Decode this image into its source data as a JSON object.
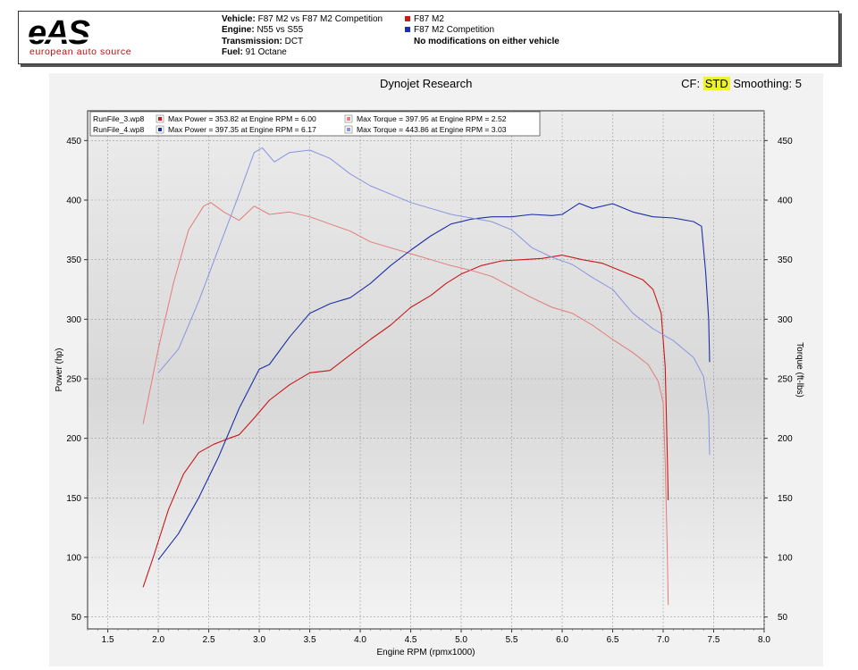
{
  "header": {
    "logo_text": "eAS",
    "logo_subtitle": "european auto source",
    "vehicle_label": "Vehicle:",
    "vehicle_value": "F87 M2 vs F87 M2 Competition",
    "engine_label": "Engine:",
    "engine_value": "N55 vs S55",
    "transmission_label": "Transmission:",
    "transmission_value": "DCT",
    "fuel_label": "Fuel:",
    "fuel_value": "91 Octane",
    "legend_1": "F87 M2",
    "legend_1_color": "#d01818",
    "legend_2": "F87 M2 Competition",
    "legend_2_color": "#1c2fb0",
    "note": "No modifications on either vehicle"
  },
  "dyno": {
    "title": "Dynojet Research",
    "cf_label": "CF:",
    "cf_value": "STD",
    "smoothing_label": "Smoothing:",
    "smoothing_value": "5"
  },
  "chart_data": {
    "type": "line",
    "xlabel": "Engine RPM (rpmx1000)",
    "ylabel_left": "Power (hp)",
    "ylabel_right": "Torque (ft-lbs)",
    "xlim": [
      1.3,
      8.0
    ],
    "ylim": [
      40,
      475
    ],
    "x_ticks": [
      1.5,
      2.0,
      2.5,
      3.0,
      3.5,
      4.0,
      4.5,
      5.0,
      5.5,
      6.0,
      6.5,
      7.0,
      7.5,
      8.0
    ],
    "y_ticks": [
      50,
      100,
      150,
      200,
      250,
      300,
      350,
      400,
      450
    ],
    "grid": true,
    "legend": [
      {
        "file": "RunFile_3.wp8",
        "power_text": "Max Power = 353.82 at Engine RPM = 6.00",
        "torque_text": "Max Torque = 397.95 at Engine RPM = 2.52",
        "power_color": "#c81818",
        "torque_color": "#e88080"
      },
      {
        "file": "RunFile_4.wp8",
        "power_text": "Max Power = 397.35 at Engine RPM = 6.17",
        "torque_text": "Max Torque = 443.86 at Engine RPM = 3.03",
        "power_color": "#1c2fa8",
        "torque_color": "#8a94e0"
      }
    ],
    "series": [
      {
        "name": "RunFile_3.wp8 Power",
        "color": "#c81818",
        "width": 1.1,
        "points": [
          [
            1.85,
            75
          ],
          [
            1.95,
            100
          ],
          [
            2.1,
            140
          ],
          [
            2.25,
            170
          ],
          [
            2.4,
            188
          ],
          [
            2.55,
            195
          ],
          [
            2.7,
            200
          ],
          [
            2.8,
            203
          ],
          [
            2.95,
            217
          ],
          [
            3.1,
            232
          ],
          [
            3.3,
            245
          ],
          [
            3.5,
            255
          ],
          [
            3.7,
            257
          ],
          [
            3.9,
            270
          ],
          [
            4.1,
            283
          ],
          [
            4.3,
            295
          ],
          [
            4.5,
            310
          ],
          [
            4.7,
            320
          ],
          [
            4.85,
            330
          ],
          [
            5.0,
            338
          ],
          [
            5.2,
            345
          ],
          [
            5.4,
            349
          ],
          [
            5.6,
            350
          ],
          [
            5.8,
            351
          ],
          [
            6.0,
            353.8
          ],
          [
            6.2,
            350
          ],
          [
            6.4,
            347
          ],
          [
            6.6,
            340
          ],
          [
            6.8,
            333
          ],
          [
            6.9,
            325
          ],
          [
            6.98,
            305
          ],
          [
            7.02,
            260
          ],
          [
            7.04,
            190
          ],
          [
            7.05,
            148
          ]
        ]
      },
      {
        "name": "RunFile_3.wp8 Torque",
        "color": "#e47a7a",
        "width": 1.0,
        "points": [
          [
            1.85,
            212
          ],
          [
            2.0,
            275
          ],
          [
            2.15,
            330
          ],
          [
            2.3,
            375
          ],
          [
            2.45,
            395
          ],
          [
            2.52,
            398
          ],
          [
            2.65,
            390
          ],
          [
            2.8,
            383
          ],
          [
            2.95,
            395
          ],
          [
            3.1,
            388
          ],
          [
            3.3,
            390
          ],
          [
            3.5,
            386
          ],
          [
            3.7,
            380
          ],
          [
            3.9,
            374
          ],
          [
            4.1,
            365
          ],
          [
            4.3,
            360
          ],
          [
            4.5,
            355
          ],
          [
            4.7,
            350
          ],
          [
            4.9,
            345
          ],
          [
            5.1,
            341
          ],
          [
            5.3,
            336
          ],
          [
            5.5,
            327
          ],
          [
            5.7,
            318
          ],
          [
            5.9,
            310
          ],
          [
            6.1,
            305
          ],
          [
            6.3,
            295
          ],
          [
            6.5,
            283
          ],
          [
            6.7,
            272
          ],
          [
            6.85,
            262
          ],
          [
            6.95,
            248
          ],
          [
            7.0,
            230
          ],
          [
            7.02,
            180
          ],
          [
            7.04,
            110
          ],
          [
            7.05,
            60
          ]
        ]
      },
      {
        "name": "RunFile_4.wp8 Power",
        "color": "#1c2fa8",
        "width": 1.1,
        "points": [
          [
            2.0,
            98
          ],
          [
            2.2,
            120
          ],
          [
            2.4,
            150
          ],
          [
            2.6,
            185
          ],
          [
            2.8,
            225
          ],
          [
            3.0,
            258
          ],
          [
            3.1,
            262
          ],
          [
            3.3,
            285
          ],
          [
            3.5,
            305
          ],
          [
            3.7,
            313
          ],
          [
            3.9,
            318
          ],
          [
            4.1,
            330
          ],
          [
            4.3,
            345
          ],
          [
            4.5,
            358
          ],
          [
            4.7,
            370
          ],
          [
            4.9,
            380
          ],
          [
            5.1,
            384
          ],
          [
            5.3,
            386
          ],
          [
            5.5,
            386
          ],
          [
            5.7,
            388
          ],
          [
            5.9,
            387
          ],
          [
            6.0,
            388
          ],
          [
            6.17,
            397.3
          ],
          [
            6.3,
            393
          ],
          [
            6.5,
            397
          ],
          [
            6.7,
            390
          ],
          [
            6.9,
            386
          ],
          [
            7.1,
            385
          ],
          [
            7.3,
            382
          ],
          [
            7.38,
            378
          ],
          [
            7.42,
            340
          ],
          [
            7.45,
            300
          ],
          [
            7.46,
            264
          ]
        ]
      },
      {
        "name": "RunFile_4.wp8 Torque",
        "color": "#8a94e0",
        "width": 1.0,
        "points": [
          [
            2.0,
            255
          ],
          [
            2.2,
            275
          ],
          [
            2.4,
            315
          ],
          [
            2.6,
            360
          ],
          [
            2.8,
            405
          ],
          [
            2.95,
            440
          ],
          [
            3.03,
            443.9
          ],
          [
            3.15,
            432
          ],
          [
            3.3,
            440
          ],
          [
            3.5,
            442
          ],
          [
            3.7,
            435
          ],
          [
            3.9,
            422
          ],
          [
            4.1,
            412
          ],
          [
            4.3,
            405
          ],
          [
            4.5,
            398
          ],
          [
            4.7,
            393
          ],
          [
            4.9,
            388
          ],
          [
            5.1,
            385
          ],
          [
            5.3,
            382
          ],
          [
            5.5,
            375
          ],
          [
            5.7,
            360
          ],
          [
            5.9,
            352
          ],
          [
            6.1,
            346
          ],
          [
            6.3,
            335
          ],
          [
            6.5,
            325
          ],
          [
            6.7,
            305
          ],
          [
            6.9,
            292
          ],
          [
            7.1,
            282
          ],
          [
            7.3,
            268
          ],
          [
            7.4,
            252
          ],
          [
            7.45,
            220
          ],
          [
            7.46,
            186
          ]
        ]
      }
    ]
  }
}
